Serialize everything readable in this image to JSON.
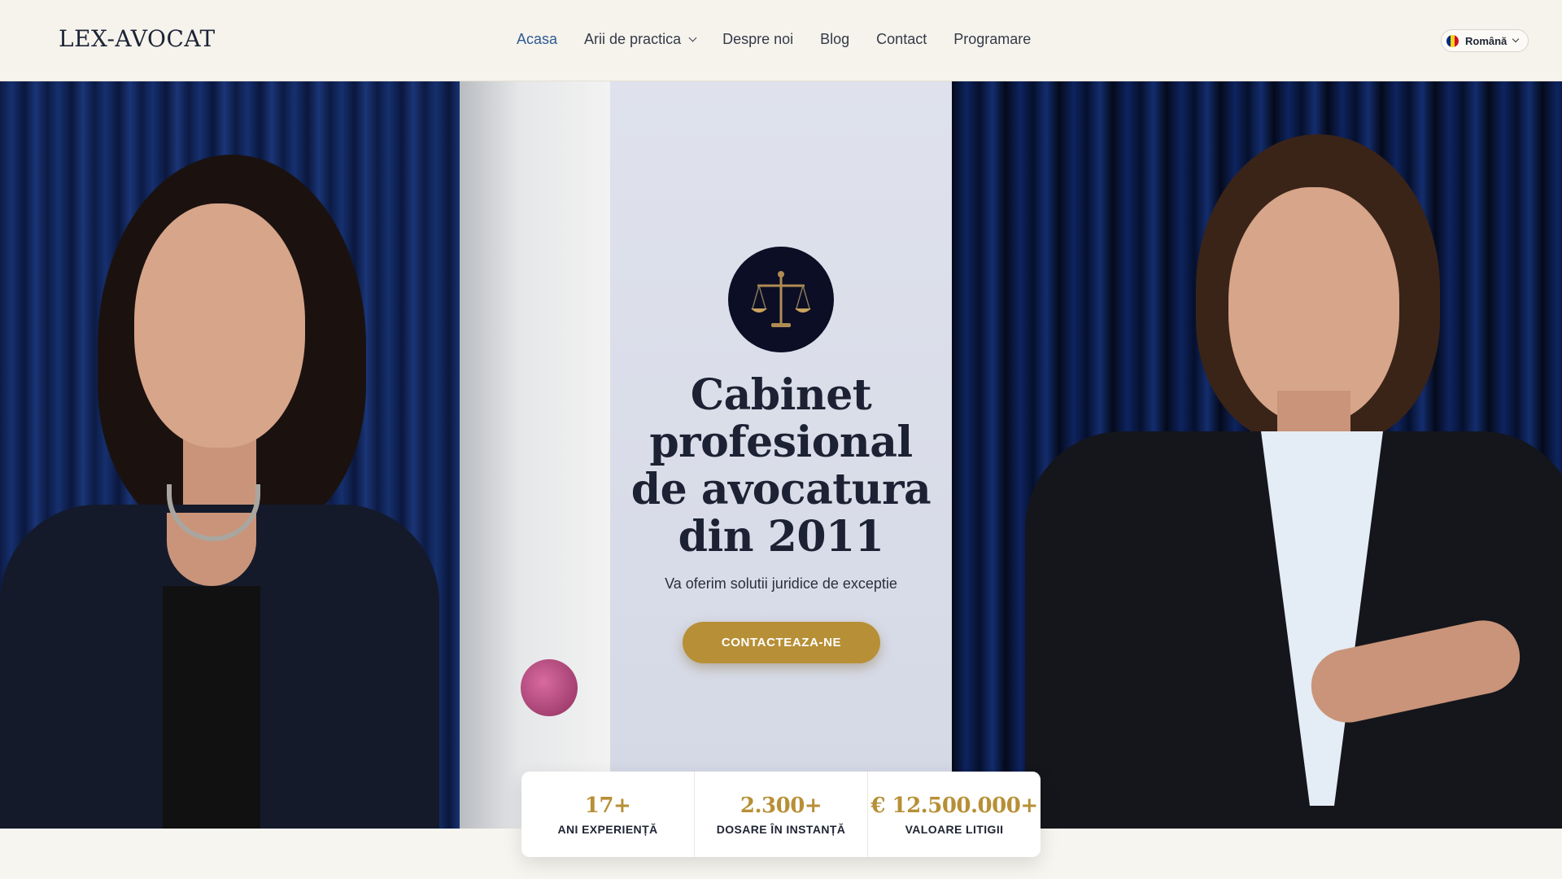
{
  "brand": {
    "logo": "LEX-AVOCAT"
  },
  "nav": {
    "items": [
      {
        "label": "Acasa",
        "active": true
      },
      {
        "label": "Arii de practica",
        "has_dropdown": true
      },
      {
        "label": "Despre noi"
      },
      {
        "label": "Blog"
      },
      {
        "label": "Contact"
      },
      {
        "label": "Programare"
      }
    ]
  },
  "language": {
    "label": "Română",
    "flag_colors": [
      "#002b7f",
      "#fcd116",
      "#ce1126"
    ]
  },
  "hero": {
    "headline": "Cabinet profesional de avocatura din 2011",
    "subline": "Va oferim solutii juridice de exceptie",
    "cta_label": "CONTACTEAZA-NE",
    "icon": "scales-of-justice-icon"
  },
  "stats": [
    {
      "value": "17+",
      "label": "ANI EXPERIENȚĂ"
    },
    {
      "value": "2.300+",
      "label": "DOSARE ÎN INSTANȚĂ"
    },
    {
      "value": "€ 12.500.000+",
      "label": "VALOARE LITIGII"
    }
  ],
  "colors": {
    "accent": "#b78f36",
    "nav_active": "#2e5a92",
    "dark": "#1f2433"
  }
}
